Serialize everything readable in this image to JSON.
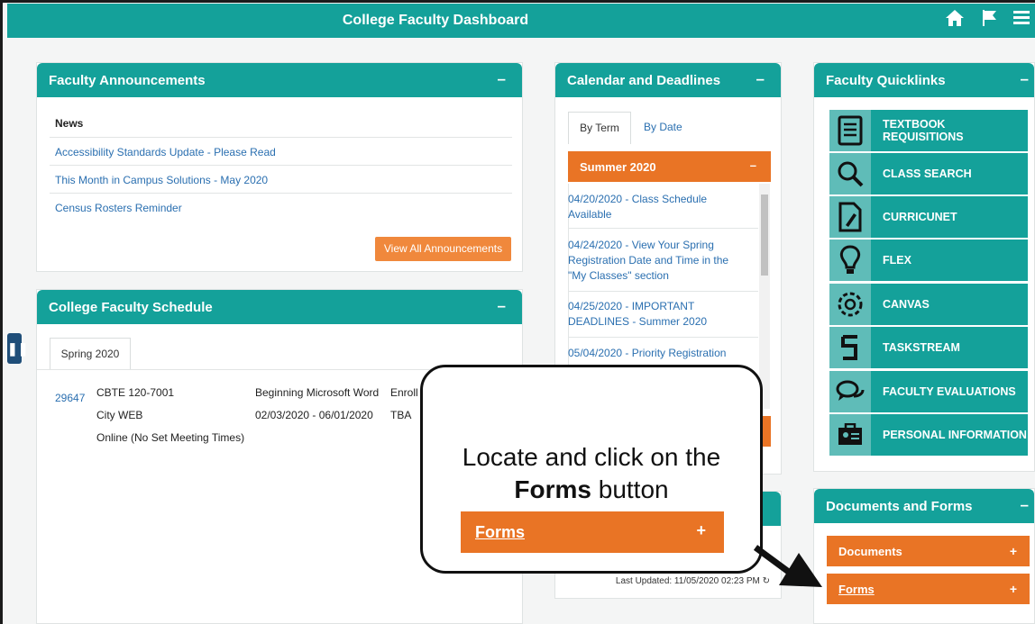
{
  "header": {
    "title": "College Faculty Dashboard"
  },
  "announcements": {
    "title": "Faculty Announcements",
    "collapse": "–",
    "news_heading": "News",
    "items": [
      "Accessibility Standards Update - Please Read",
      "This Month in Campus Solutions - May 2020",
      "Census Rosters Reminder"
    ],
    "view_all": "View All Announcements"
  },
  "schedule": {
    "title": "College Faculty Schedule",
    "collapse": "–",
    "tab": "Spring 2020",
    "class_nbr": "29647",
    "course": "CBTE 120-7001",
    "location": "City WEB",
    "meeting": "Online (No Set Meeting Times)",
    "description": "Beginning Microsoft Word",
    "dates": "02/03/2020 - 06/01/2020",
    "status": "Enroll",
    "room": "TBA"
  },
  "calendar": {
    "title": "Calendar and Deadlines",
    "collapse": "–",
    "tab_term": "By Term",
    "tab_date": "By Date",
    "term": "Summer 2020",
    "term_collapse": "–",
    "items": [
      "04/20/2020 - Class Schedule Available",
      "04/24/2020 - View Your Spring Registration Date and Time in the \"My Classes\" section",
      "04/25/2020 - IMPORTANT DEADLINES - Summer 2020",
      "05/04/2020 - Priority Registration"
    ],
    "last_updated": "Last Updated: 11/05/2020 02:23 PM"
  },
  "quicklinks": {
    "title": "Faculty Quicklinks",
    "collapse": "–",
    "items": [
      {
        "label": "TEXTBOOK REQUISITIONS",
        "icon": "book-icon"
      },
      {
        "label": "CLASS SEARCH",
        "icon": "magnifier-icon"
      },
      {
        "label": "CURRICUNET",
        "icon": "document-edit-icon"
      },
      {
        "label": "FLEX",
        "icon": "lightbulb-icon"
      },
      {
        "label": "CANVAS",
        "icon": "canvas-logo-icon"
      },
      {
        "label": "TASKSTREAM",
        "icon": "taskstream-logo-icon"
      },
      {
        "label": "FACULTY EVALUATIONS",
        "icon": "chat-bubbles-icon"
      },
      {
        "label": "PERSONAL INFORMATION",
        "icon": "id-card-icon"
      }
    ]
  },
  "docs": {
    "title": "Documents and Forms",
    "collapse": "–",
    "documents": "Documents",
    "forms": "Forms",
    "plus": "+"
  },
  "callout": {
    "line1": "Locate and click on the",
    "bold": "Forms",
    "line2_rest": " button",
    "button": "Forms",
    "plus": "+"
  }
}
